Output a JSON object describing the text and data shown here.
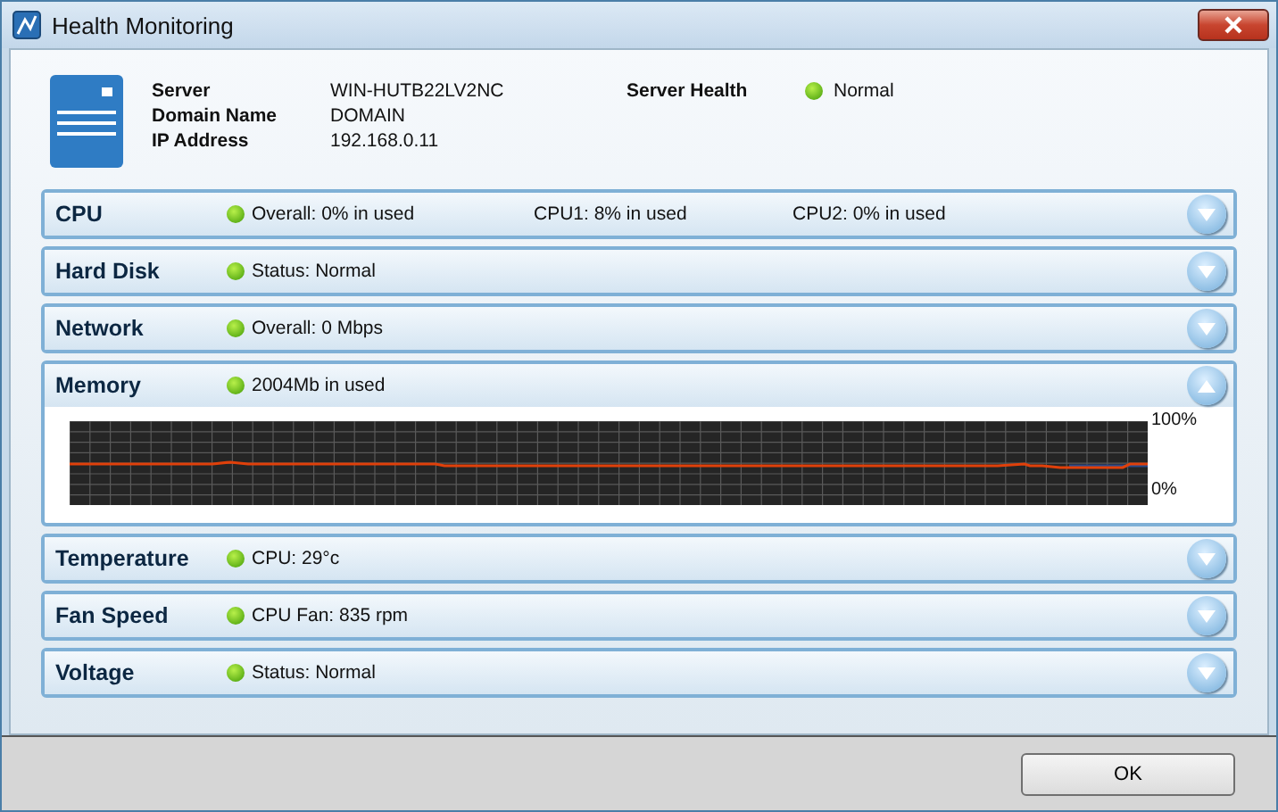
{
  "window": {
    "title": "Health Monitoring"
  },
  "server_info": {
    "fields": [
      {
        "label": "Server",
        "value": "WIN-HUTB22LV2NC"
      },
      {
        "label": "Domain Name",
        "value": "DOMAIN"
      },
      {
        "label": "IP Address",
        "value": "192.168.0.11"
      }
    ],
    "health_label": "Server Health",
    "health_value": "Normal"
  },
  "sections": [
    {
      "name": "CPU",
      "expanded": false,
      "statuses": [
        "Overall: 0% in used",
        "CPU1: 8% in used",
        "CPU2: 0% in used"
      ]
    },
    {
      "name": "Hard Disk",
      "expanded": false,
      "statuses": [
        "Status: Normal"
      ]
    },
    {
      "name": "Network",
      "expanded": false,
      "statuses": [
        "Overall: 0 Mbps"
      ]
    },
    {
      "name": "Memory",
      "expanded": true,
      "statuses": [
        "2004Mb in used"
      ],
      "graph": {
        "kind": "picture",
        "top_label": "100%",
        "bottom_label": "0%"
      }
    },
    {
      "name": "Temperature",
      "expanded": false,
      "statuses": [
        "CPU: 29°c"
      ]
    },
    {
      "name": "Fan Speed",
      "expanded": false,
      "statuses": [
        "CPU Fan: 835 rpm"
      ]
    },
    {
      "name": "Voltage",
      "expanded": false,
      "statuses": [
        "Status: Normal"
      ]
    }
  ],
  "buttons": [
    "OK"
  ]
}
